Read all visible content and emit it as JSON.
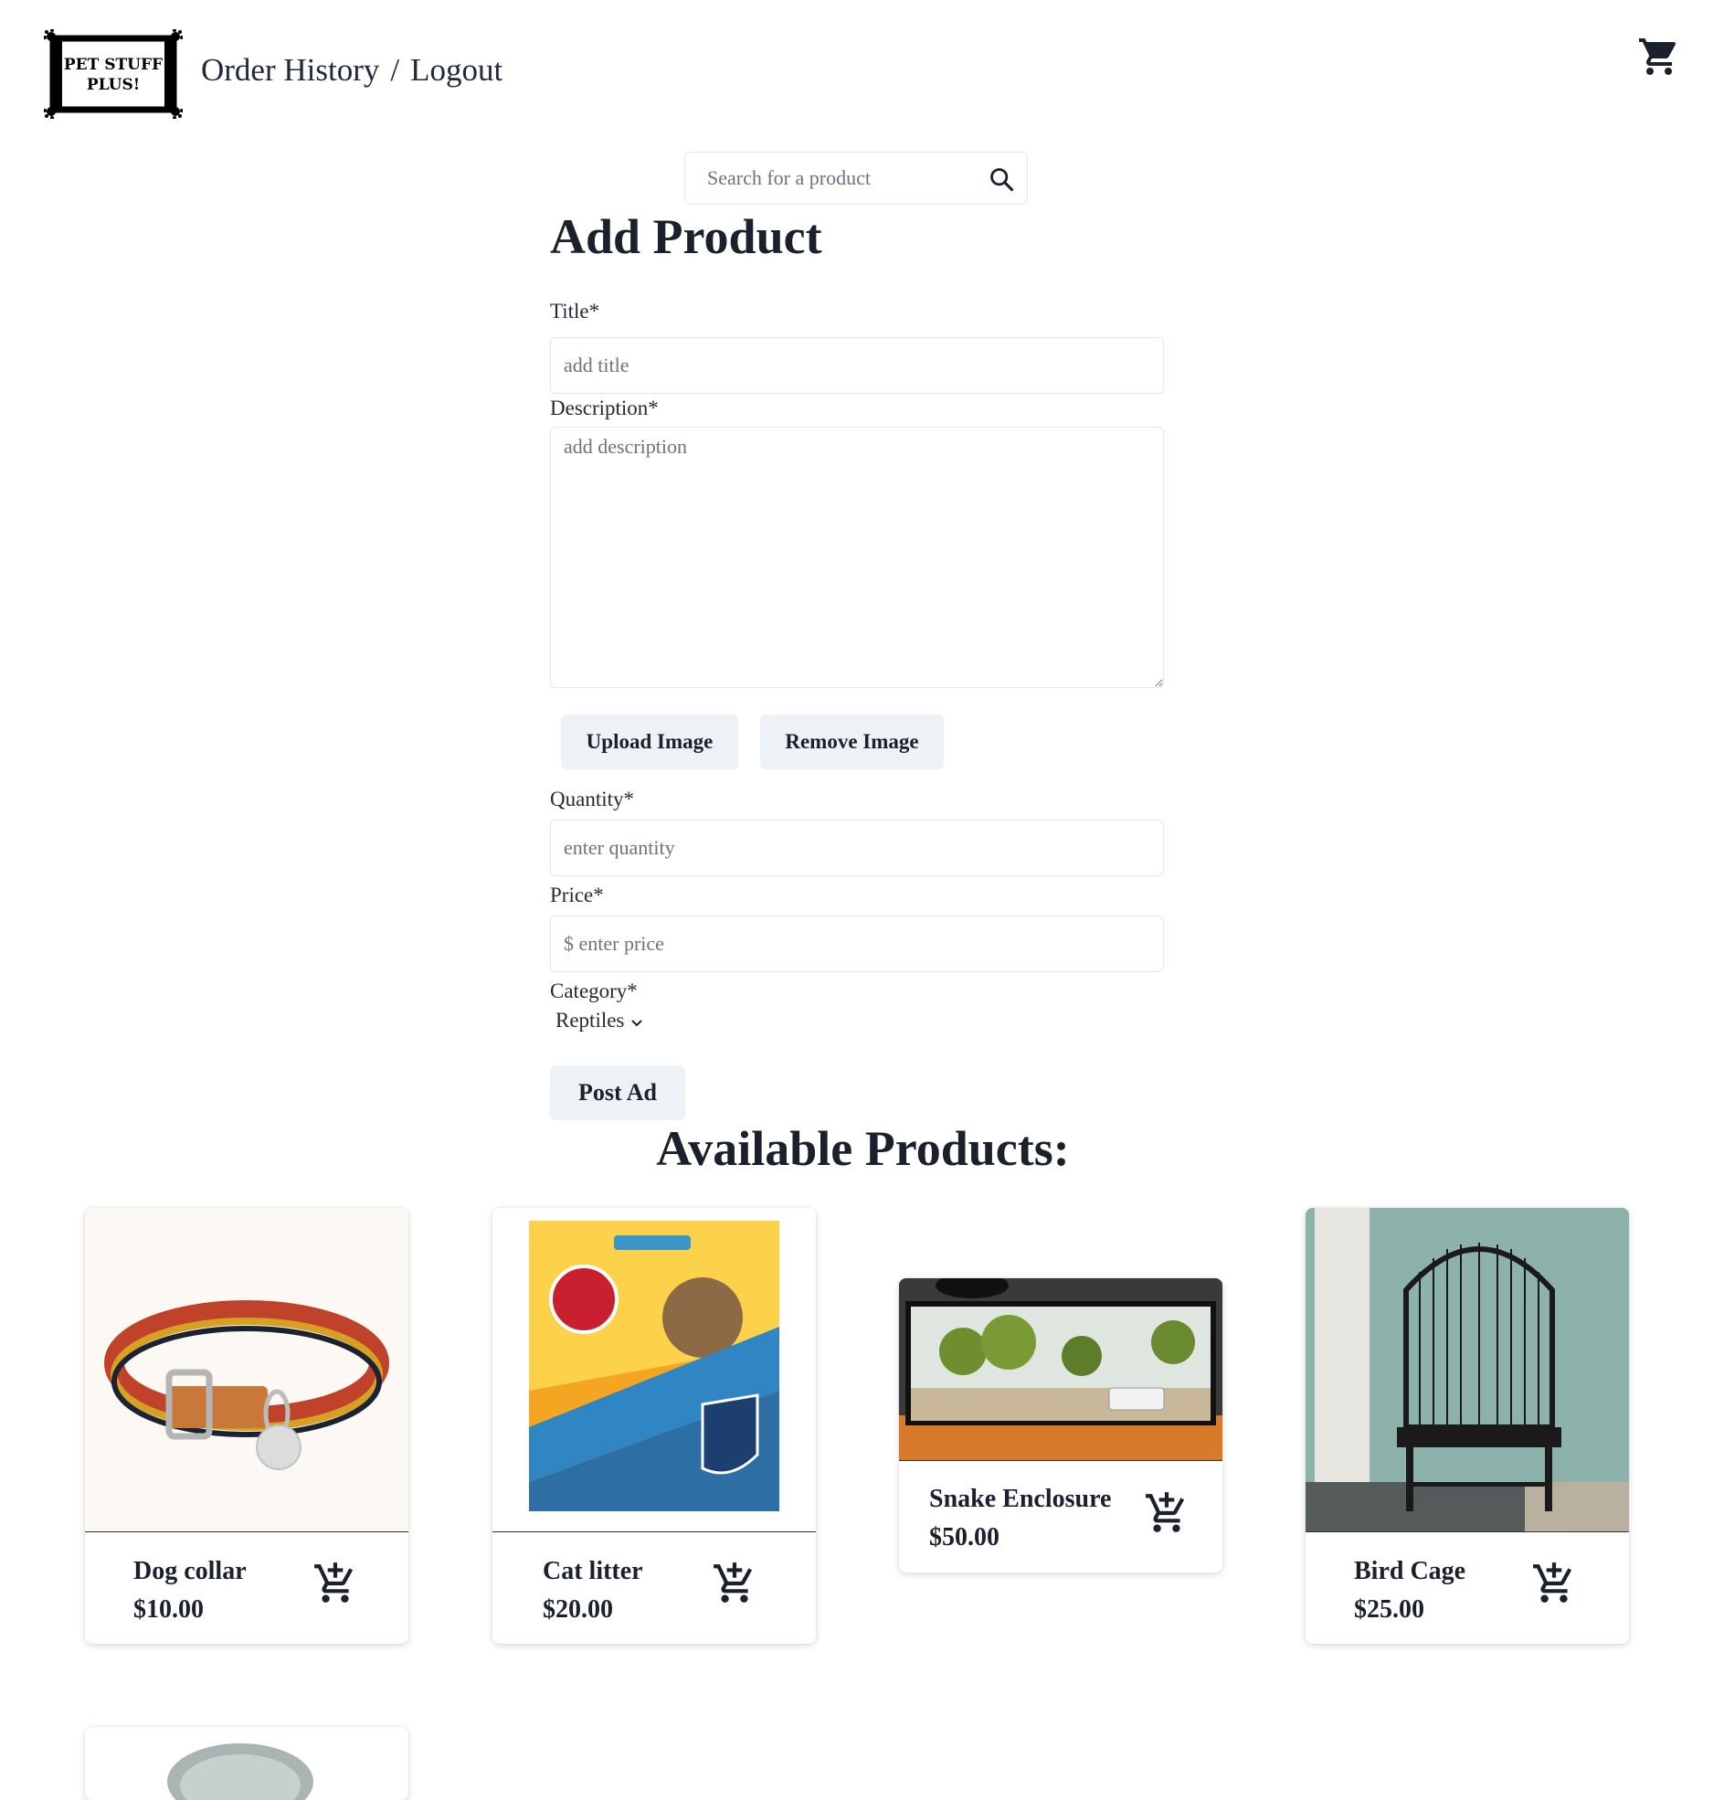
{
  "header": {
    "logo_text_line1": "PET STUFF",
    "logo_text_line2": "PLUS!",
    "nav_order_history": "Order History",
    "nav_separator": "/",
    "nav_logout": "Logout",
    "cart_icon": "cart-icon"
  },
  "search": {
    "placeholder": "Search for a product",
    "icon": "search-icon"
  },
  "form": {
    "heading": "Add Product",
    "title_label": "Title*",
    "title_placeholder": "add title",
    "description_label": "Description*",
    "description_placeholder": "add description",
    "upload_button": "Upload Image",
    "remove_button": "Remove Image",
    "quantity_label": "Quantity*",
    "quantity_placeholder": "enter quantity",
    "price_label": "Price*",
    "price_placeholder": "$ enter price",
    "category_label": "Category*",
    "category_value": "Reptiles",
    "post_button": "Post Ad"
  },
  "products_heading": "Available Products:",
  "products": [
    {
      "name": "Dog collar",
      "price": "$10.00"
    },
    {
      "name": "Cat litter",
      "price": "$20.00"
    },
    {
      "name": "Snake Enclosure",
      "price": "$50.00"
    },
    {
      "name": "Bird Cage",
      "price": "$25.00"
    }
  ],
  "colors": {
    "text": "#1a202c",
    "button_bg": "#edf2f7",
    "border": "#e2e8f0"
  }
}
